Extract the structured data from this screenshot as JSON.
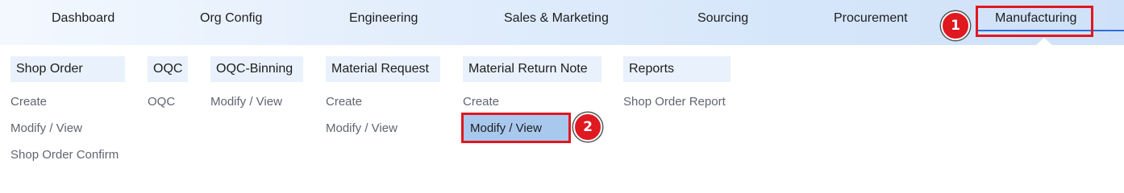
{
  "nav": {
    "items": [
      {
        "label": "Dashboard"
      },
      {
        "label": "Org Config"
      },
      {
        "label": "Engineering"
      },
      {
        "label": "Sales & Marketing"
      },
      {
        "label": "Sourcing"
      },
      {
        "label": "Procurement"
      },
      {
        "label": "Manufacturing"
      }
    ],
    "active": "Manufacturing"
  },
  "menu": {
    "columns": [
      {
        "header": "Shop Order",
        "links": [
          "Create",
          "Modify / View",
          "Shop Order Confirm"
        ]
      },
      {
        "header": "OQC",
        "links": [
          "OQC"
        ]
      },
      {
        "header": "OQC-Binning",
        "links": [
          "Modify / View"
        ]
      },
      {
        "header": "Material Request",
        "links": [
          "Create",
          "Modify / View"
        ]
      },
      {
        "header": "Material Return Note",
        "links": [
          "Create",
          "Modify / View"
        ]
      },
      {
        "header": "Reports",
        "links": [
          "Shop Order Report"
        ]
      }
    ],
    "selected": "Material Return Note / Modify / View"
  },
  "annotations": {
    "step1": "1",
    "step2": "2",
    "color": "#e01820"
  },
  "colors": {
    "header_bg": "#e9f1fc",
    "selected_bg": "#a9c8ee",
    "link_text": "#5f6570"
  }
}
